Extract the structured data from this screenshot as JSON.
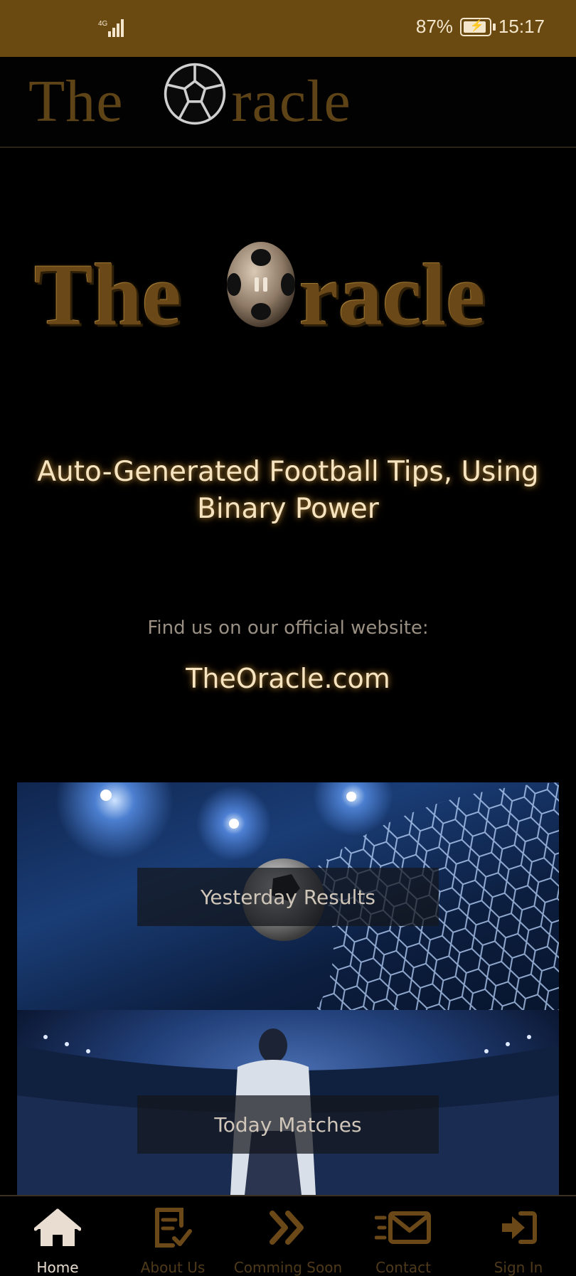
{
  "status_bar": {
    "network": "4G",
    "battery_percent": "87%",
    "battery_level": 0.87,
    "time": "15:17"
  },
  "header": {
    "logo_text_left": "The",
    "logo_text_right": "racle",
    "logo_icon": "soccer-ball-icon"
  },
  "hero": {
    "logo_text_left": "The",
    "logo_text_right": "racle"
  },
  "tagline": "Auto-Generated Football Tips, Using Binary Power",
  "find_us_label": "Find us on our official website:",
  "website": "TheOracle.com",
  "cards": {
    "yesterday_label": "Yesterday Results",
    "today_label": "Today Matches"
  },
  "bottom_nav": {
    "items": [
      {
        "label": "Home",
        "icon": "home-icon",
        "active": true
      },
      {
        "label": "About Us",
        "icon": "document-check-icon",
        "active": false
      },
      {
        "label": "Comming Soon",
        "icon": "double-chevron-right-icon",
        "active": false
      },
      {
        "label": "Contact",
        "icon": "mail-icon",
        "active": false
      },
      {
        "label": "Sign In",
        "icon": "sign-in-icon",
        "active": false
      }
    ]
  },
  "colors": {
    "status_bar_bg": "#6b4a12",
    "accent_gold": "#6b4817",
    "glow_text": "#f6e3c0",
    "nav_inactive": "#4e3a1a"
  }
}
